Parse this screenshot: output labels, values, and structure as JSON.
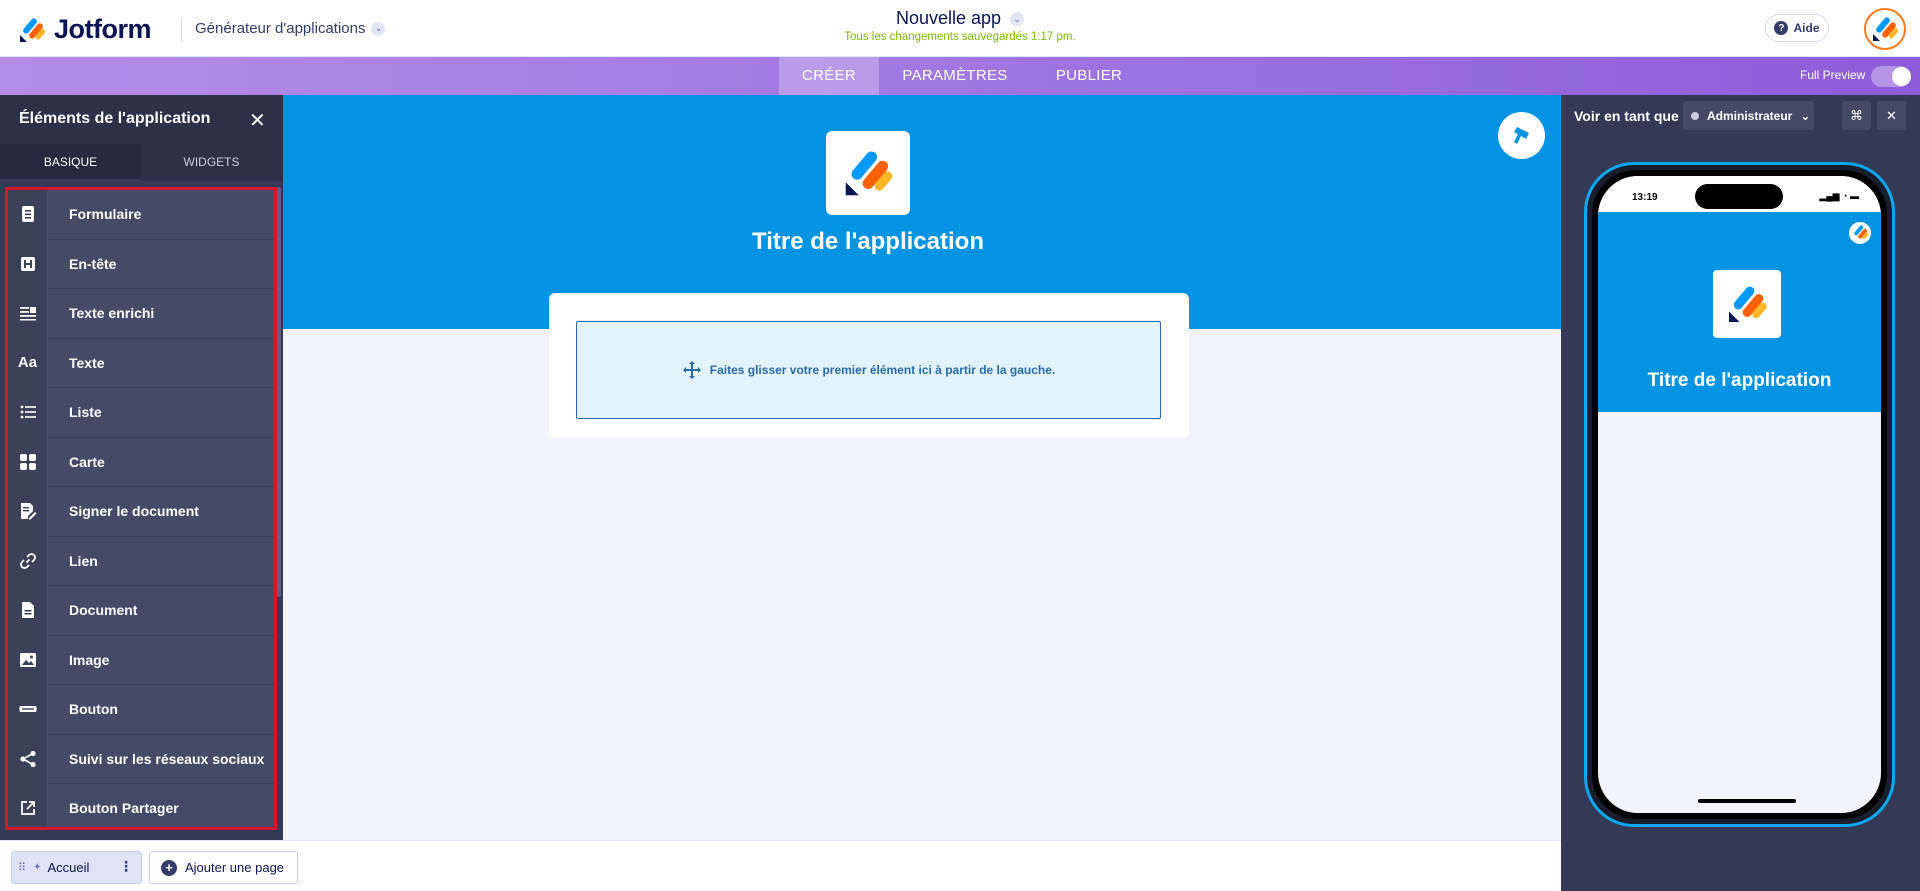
{
  "header": {
    "brand": "Jotform",
    "builder_label": "Générateur d'applications",
    "app_title": "Nouvelle app",
    "saved_status": "Tous les changements sauvegardés 1:17 pm.",
    "help_label": "Aide"
  },
  "nav": {
    "tabs": [
      {
        "label": "CRÉER",
        "active": true
      },
      {
        "label": "PARAMÈTRES",
        "active": false
      },
      {
        "label": "PUBLIER",
        "active": false
      }
    ],
    "full_preview_label": "Full Preview",
    "full_preview_on": false
  },
  "left_panel": {
    "title": "Éléments de l'application",
    "tabs": [
      {
        "label": "BASIQUE",
        "active": true
      },
      {
        "label": "WIDGETS",
        "active": false
      }
    ],
    "items": [
      {
        "label": "Formulaire",
        "icon": "form-icon"
      },
      {
        "label": "En-tête",
        "icon": "heading-icon"
      },
      {
        "label": "Texte enrichi",
        "icon": "rich-text-icon"
      },
      {
        "label": "Texte",
        "icon": "text-icon"
      },
      {
        "label": "Liste",
        "icon": "list-icon"
      },
      {
        "label": "Carte",
        "icon": "card-icon"
      },
      {
        "label": "Signer le document",
        "icon": "sign-document-icon"
      },
      {
        "label": "Lien",
        "icon": "link-icon"
      },
      {
        "label": "Document",
        "icon": "document-icon"
      },
      {
        "label": "Image",
        "icon": "image-icon"
      },
      {
        "label": "Bouton",
        "icon": "button-icon"
      },
      {
        "label": "Suivi sur les réseaux sociaux",
        "icon": "share-icon"
      },
      {
        "label": "Bouton Partager",
        "icon": "external-share-icon"
      }
    ]
  },
  "canvas": {
    "app_title": "Titre de l'application",
    "drop_hint": "Faites glisser votre premier élément ici à partir de la gauche.",
    "hero_color": "#0294e3"
  },
  "pages_bar": {
    "pages": [
      {
        "label": "Accueil"
      }
    ],
    "add_page_label": "Ajouter une page"
  },
  "preview": {
    "view_as_label": "Voir en tant que",
    "role": "Administrateur",
    "status_time": "13:19",
    "app_title": "Titre de l'application"
  },
  "colors": {
    "accent_purple": "#a177e2",
    "hero_blue": "#0294e3",
    "highlight_red": "#d0192b",
    "saved_green": "#7dbb00"
  }
}
